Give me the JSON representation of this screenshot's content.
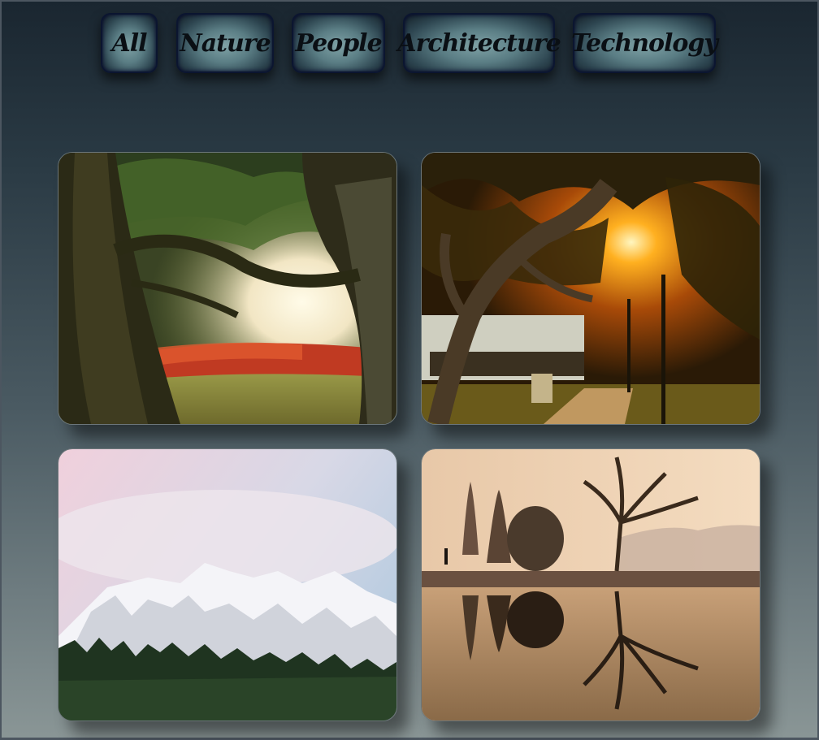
{
  "filters": [
    {
      "label": "All",
      "id": "all"
    },
    {
      "label": "Nature",
      "id": "nature"
    },
    {
      "label": "People",
      "id": "people"
    },
    {
      "label": "Architecture",
      "id": "architecture"
    },
    {
      "label": "Technology",
      "id": "technology"
    }
  ],
  "gallery": {
    "items": [
      {
        "subject": "forest-trees-sunlight-photo"
      },
      {
        "subject": "park-sunset-tree-photo"
      },
      {
        "subject": "snowy-mountain-forest-photo"
      },
      {
        "subject": "lake-tree-reflection-photo"
      }
    ]
  }
}
